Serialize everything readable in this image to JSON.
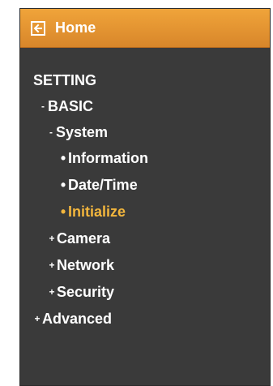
{
  "header": {
    "title": "Home",
    "back_icon": "back-arrow-icon"
  },
  "menu": {
    "root": "SETTING",
    "basic": {
      "prefix": "-",
      "label": "BASIC"
    },
    "system": {
      "prefix": "-",
      "label": "System"
    },
    "system_children": [
      {
        "prefix": "•",
        "label": "Information"
      },
      {
        "prefix": "•",
        "label": "Date/Time"
      },
      {
        "prefix": "•",
        "label": "Initialize"
      }
    ],
    "basic_children": [
      {
        "prefix": "+",
        "label": "Camera"
      },
      {
        "prefix": "+",
        "label": "Network"
      },
      {
        "prefix": "+",
        "label": "Security"
      }
    ],
    "advanced": {
      "prefix": "+",
      "label": "Advanced"
    }
  },
  "colors": {
    "panel": "#3a3a3a",
    "header_top": "#f0a43a",
    "header_bottom": "#d8862a",
    "text": "#ffffff",
    "active": "#f3b63d"
  }
}
